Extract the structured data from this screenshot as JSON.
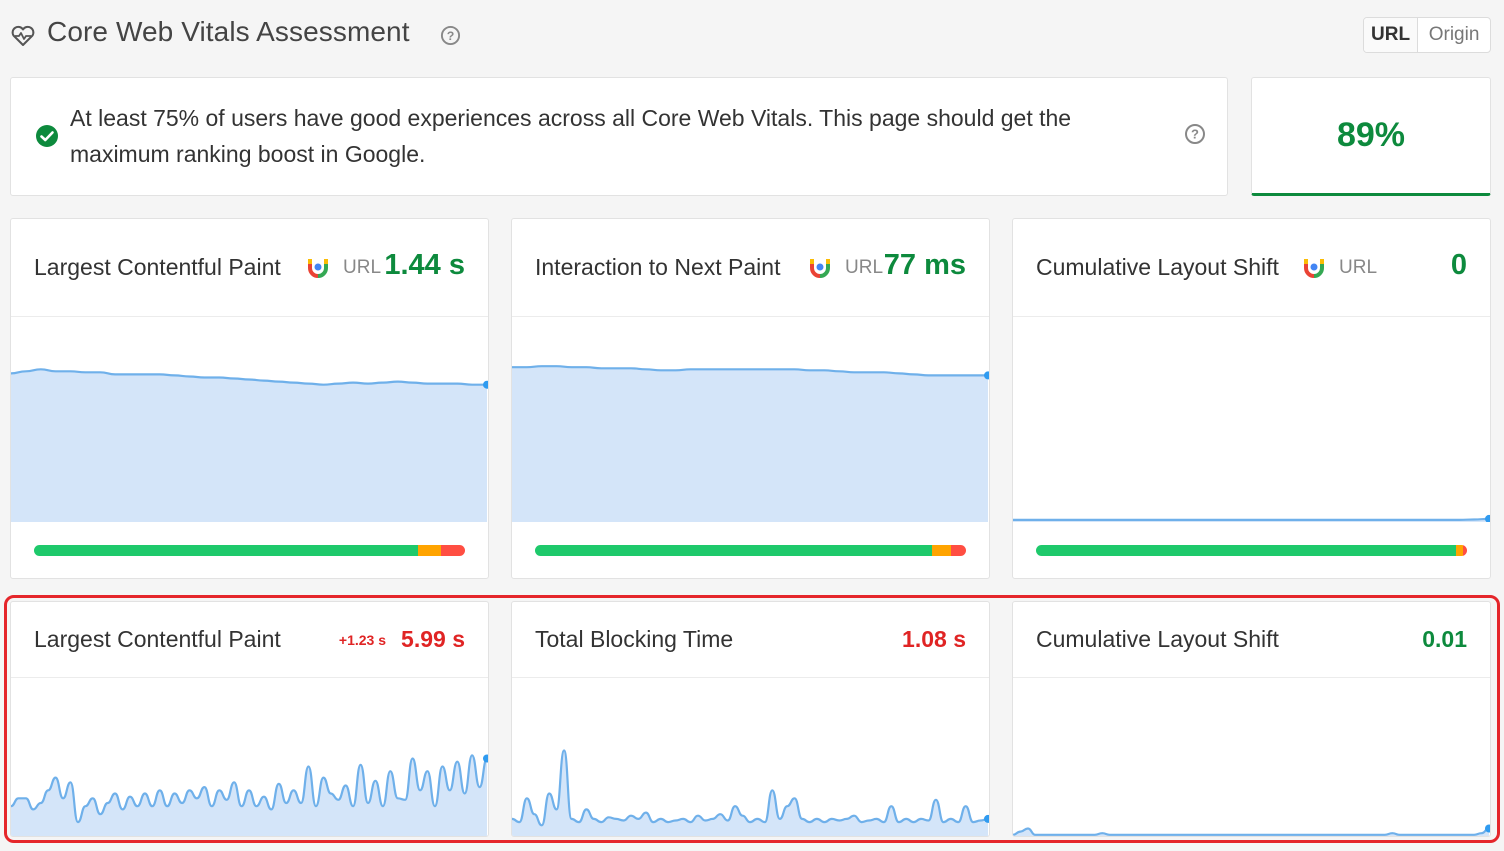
{
  "header": {
    "title": "Core Web Vitals Assessment",
    "toggle": {
      "url_label": "URL",
      "origin_label": "Origin",
      "selected": "URL"
    }
  },
  "assessment": {
    "message": "At least 75% of users have good experiences across all Core Web Vitals. This page should get the maximum ranking boost in Google.",
    "score": "89%",
    "status_color": "#0d8a3d"
  },
  "field_metrics": [
    {
      "title": "Largest Contentful Paint",
      "source_tag": "URL",
      "value": "1.44 s",
      "status": "good",
      "distribution": {
        "good": 0.89,
        "needs_improvement": 0.055,
        "poor": 0.055
      },
      "trend": [
        0.725,
        0.735,
        0.745,
        0.735,
        0.735,
        0.73,
        0.73,
        0.72,
        0.72,
        0.72,
        0.72,
        0.715,
        0.71,
        0.705,
        0.705,
        0.7,
        0.695,
        0.69,
        0.685,
        0.68,
        0.675,
        0.67,
        0.675,
        0.68,
        0.675,
        0.68,
        0.685,
        0.68,
        0.675,
        0.675,
        0.675,
        0.67,
        0.67
      ]
    },
    {
      "title": "Interaction to Next Paint",
      "source_tag": "URL",
      "value": "77 ms",
      "status": "good",
      "distribution": {
        "good": 0.92,
        "needs_improvement": 0.045,
        "poor": 0.035
      },
      "trend": [
        0.755,
        0.755,
        0.76,
        0.76,
        0.755,
        0.755,
        0.75,
        0.75,
        0.75,
        0.745,
        0.74,
        0.74,
        0.745,
        0.745,
        0.745,
        0.745,
        0.745,
        0.745,
        0.745,
        0.745,
        0.74,
        0.74,
        0.735,
        0.73,
        0.73,
        0.73,
        0.725,
        0.72,
        0.715,
        0.715,
        0.715,
        0.715,
        0.715
      ]
    },
    {
      "title": "Cumulative Layout Shift",
      "source_tag": "URL",
      "value": "0",
      "status": "good",
      "distribution": {
        "good": 0.975,
        "needs_improvement": 0.015,
        "poor": 0.01
      },
      "trend": [
        0.01,
        0.01,
        0.01,
        0.01,
        0.01,
        0.01,
        0.01,
        0.01,
        0.01,
        0.01,
        0.01,
        0.01,
        0.01,
        0.01,
        0.01,
        0.01,
        0.01,
        0.01,
        0.01,
        0.01,
        0.01,
        0.01,
        0.01,
        0.01,
        0.01,
        0.01,
        0.01,
        0.01,
        0.01,
        0.01,
        0.01,
        0.012,
        0.015
      ]
    }
  ],
  "lab_metrics": [
    {
      "title": "Largest Contentful Paint",
      "change": "+1.23 s",
      "value": "5.99 s",
      "status": "poor",
      "trend": [
        0.2,
        0.25,
        0.25,
        0.18,
        0.22,
        0.3,
        0.38,
        0.25,
        0.35,
        0.1,
        0.2,
        0.25,
        0.15,
        0.22,
        0.28,
        0.18,
        0.26,
        0.2,
        0.28,
        0.2,
        0.3,
        0.2,
        0.28,
        0.22,
        0.3,
        0.25,
        0.32,
        0.2,
        0.3,
        0.24,
        0.35,
        0.2,
        0.3,
        0.2,
        0.26,
        0.18,
        0.34,
        0.22,
        0.3,
        0.22,
        0.45,
        0.2,
        0.38,
        0.28,
        0.24,
        0.33,
        0.2,
        0.46,
        0.22,
        0.36,
        0.2,
        0.42,
        0.25,
        0.24,
        0.5,
        0.3,
        0.42,
        0.2,
        0.45,
        0.3,
        0.48,
        0.28,
        0.52,
        0.32,
        0.5
      ]
    },
    {
      "title": "Total Blocking Time",
      "value": "1.08 s",
      "status": "poor",
      "trend": [
        0.12,
        0.1,
        0.25,
        0.15,
        0.08,
        0.28,
        0.18,
        0.55,
        0.12,
        0.1,
        0.18,
        0.12,
        0.1,
        0.13,
        0.12,
        0.11,
        0.14,
        0.12,
        0.16,
        0.1,
        0.12,
        0.1,
        0.11,
        0.12,
        0.1,
        0.14,
        0.11,
        0.12,
        0.15,
        0.11,
        0.2,
        0.14,
        0.1,
        0.12,
        0.1,
        0.3,
        0.12,
        0.2,
        0.25,
        0.12,
        0.1,
        0.12,
        0.1,
        0.12,
        0.11,
        0.12,
        0.14,
        0.1,
        0.11,
        0.12,
        0.1,
        0.2,
        0.1,
        0.12,
        0.1,
        0.12,
        0.11,
        0.24,
        0.1,
        0.12,
        0.1,
        0.2,
        0.1,
        0.11,
        0.12
      ]
    },
    {
      "title": "Cumulative Layout Shift",
      "value": "0.01",
      "status": "good",
      "trend": [
        0.02,
        0.04,
        0.06,
        0.02,
        0.02,
        0.02,
        0.02,
        0.02,
        0.02,
        0.02,
        0.02,
        0.02,
        0.03,
        0.02,
        0.02,
        0.02,
        0.02,
        0.02,
        0.02,
        0.02,
        0.02,
        0.02,
        0.02,
        0.02,
        0.02,
        0.02,
        0.02,
        0.02,
        0.02,
        0.02,
        0.02,
        0.02,
        0.02,
        0.02,
        0.02,
        0.02,
        0.02,
        0.02,
        0.02,
        0.02,
        0.02,
        0.02,
        0.02,
        0.02,
        0.02,
        0.02,
        0.02,
        0.02,
        0.02,
        0.02,
        0.02,
        0.03,
        0.02,
        0.02,
        0.02,
        0.02,
        0.02,
        0.02,
        0.02,
        0.02,
        0.02,
        0.02,
        0.02,
        0.03,
        0.06
      ]
    }
  ],
  "colors": {
    "good": "#0d8a3d",
    "poor": "#e02424",
    "bar_good": "#1ec96b",
    "bar_ni": "#ffa400",
    "bar_poor": "#ff4e42",
    "chart_line": "#6fb0ea",
    "chart_fill": "#d4e5f9",
    "dot": "#2f9bf0"
  },
  "icons": [
    "heart-pulse-icon",
    "help-icon",
    "check-circle-icon",
    "crux-icon"
  ]
}
